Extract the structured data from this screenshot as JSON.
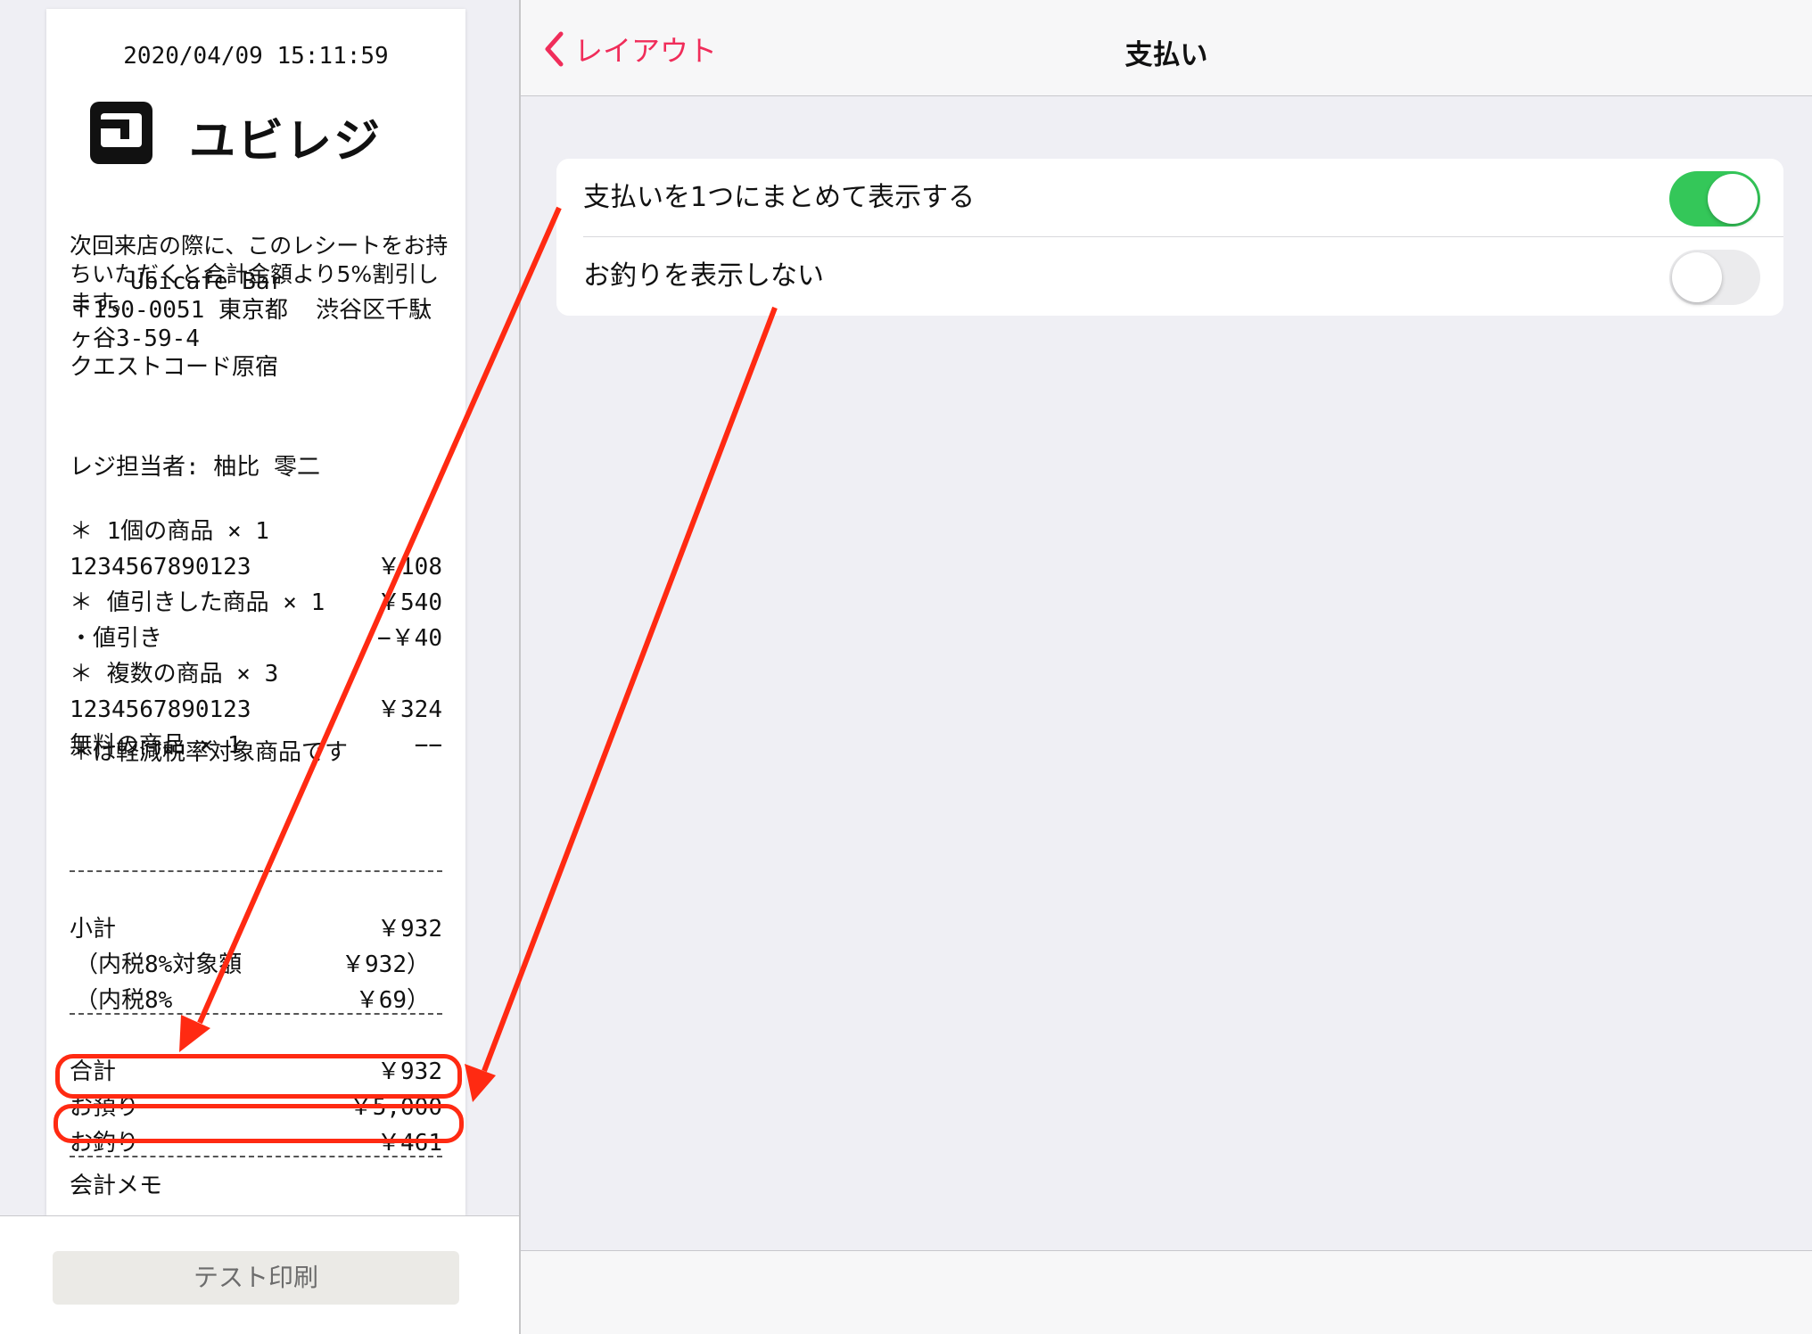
{
  "receipt": {
    "datetime": "2020/04/09 15:11:59",
    "logo_text": "ユビレジ",
    "notice": "次回来店の際に、このレシートをお持ちいただくと合計金額より5%割引します。",
    "store_name": "Ubicafe Bar",
    "address_line1": "〒150-0051 東京都  渋谷区千駄",
    "address_line2": "ヶ谷3-59-4",
    "address_line3": "クエストコード原宿",
    "cashier": "レジ担当者: 柚比 零二",
    "items": [
      {
        "left": "＊ 1個の商品 × 1",
        "right": ""
      },
      {
        "left": "1234567890123",
        "right": "￥108"
      },
      {
        "left": "＊ 値引きした商品 × 1",
        "right": "￥540"
      },
      {
        "left": "・値引き",
        "right": "−￥40"
      },
      {
        "left": "＊ 複数の商品 × 3",
        "right": ""
      },
      {
        "left": "1234567890123",
        "right": "￥324"
      },
      {
        "left": "無料の商品 × 1",
        "right": "−−"
      }
    ],
    "reduced_tax_note": "＊は軽減税率対象商品です",
    "subtotal_label": "小計",
    "subtotal_value": "￥932",
    "tax_base_label": "（内税8%対象額",
    "tax_base_value": "￥932）",
    "tax_label": "（内税8%",
    "tax_value": "￥69）",
    "total_label": "合計",
    "total_value": "￥932",
    "deposit_label": "お預り",
    "deposit_value": "￥5,000",
    "change_label": "お釣り",
    "change_value": "￥461",
    "memo_label": "会計メモ"
  },
  "left_footer": {
    "test_print_label": "テスト印刷"
  },
  "navbar": {
    "back_label": "レイアウト",
    "title": "支払い"
  },
  "settings": {
    "rows": [
      {
        "label": "支払いを1つにまとめて表示する",
        "enabled": true
      },
      {
        "label": "お釣りを表示しない",
        "enabled": false
      }
    ]
  },
  "colors": {
    "accent": "#f02d5a",
    "toggle_on": "#34c759",
    "annotation_red": "#ff2a12"
  }
}
